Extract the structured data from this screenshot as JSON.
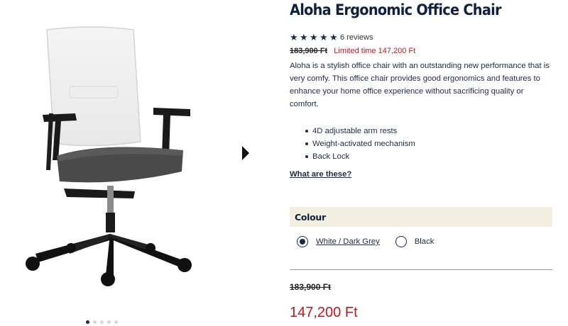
{
  "product": {
    "title": "Aloha Ergonomic Office Chair",
    "rating": 5,
    "reviews_text": "6 reviews",
    "old_price": "183,900 Ft",
    "limited_text": "Limited time 147,200 Ft",
    "description": "Aloha is a stylish office chair with an outstanding new performance that is very comfy. This office chair provides good ergonomics and features to enhance your home office experience without sacrificing quality or comfort.",
    "features": [
      "4D adjustable arm rests",
      "Weight-activated mechanism",
      "Back Lock"
    ],
    "what_link": "What are these?"
  },
  "colour": {
    "label": "Colour",
    "options": [
      {
        "label": "White / Dark Grey",
        "selected": true
      },
      {
        "label": "Black",
        "selected": false
      }
    ]
  },
  "price": {
    "old": "183,900 Ft",
    "current": "147,200 Ft"
  },
  "gallery": {
    "image_count": 5,
    "active_index": 0,
    "icons": {
      "next": "chevron-right-icon",
      "star": "star-icon"
    }
  },
  "colors": {
    "navy": "#102040",
    "sale_red": "#c0161c",
    "colour_bar_bg": "#f3efe0"
  }
}
